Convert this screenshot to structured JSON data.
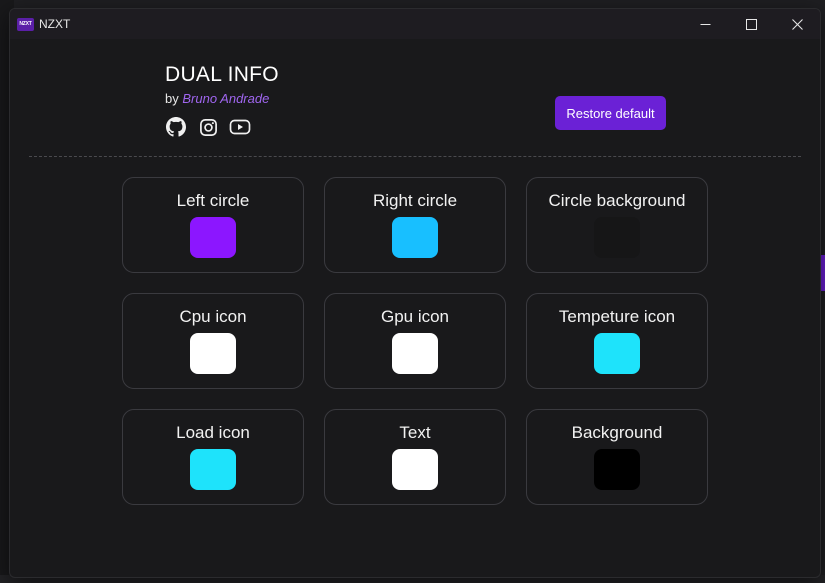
{
  "window": {
    "title": "NZXT",
    "icon_text": "NZXT",
    "icon_color": "#5b1fa8"
  },
  "header": {
    "title": "DUAL INFO",
    "by": "by",
    "author": "Bruno Andrade",
    "socials": [
      "github-icon",
      "instagram-icon",
      "youtube-icon"
    ]
  },
  "actions": {
    "restore_label": "Restore default",
    "accent_color": "#6b21d6"
  },
  "colors": [
    {
      "label": "Left circle",
      "color": "#8c16ff"
    },
    {
      "label": "Right circle",
      "color": "#18bfff"
    },
    {
      "label": "Circle background",
      "color": "#161617"
    },
    {
      "label": "Cpu icon",
      "color": "#ffffff"
    },
    {
      "label": "Gpu icon",
      "color": "#ffffff"
    },
    {
      "label": "Tempeture icon",
      "color": "#1ee3fb"
    },
    {
      "label": "Load icon",
      "color": "#1ee3fb"
    },
    {
      "label": "Text",
      "color": "#ffffff"
    },
    {
      "label": "Background",
      "color": "#000000"
    }
  ]
}
